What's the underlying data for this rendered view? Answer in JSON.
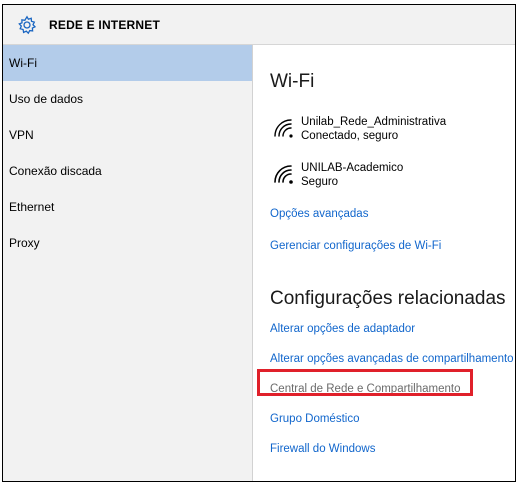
{
  "titlebar": {
    "icon": "gear-icon",
    "title": "REDE E INTERNET"
  },
  "sidebar": {
    "items": [
      {
        "label": "Wi-Fi",
        "active": true
      },
      {
        "label": "Uso de dados"
      },
      {
        "label": "VPN"
      },
      {
        "label": "Conexão discada"
      },
      {
        "label": "Ethernet"
      },
      {
        "label": "Proxy"
      }
    ]
  },
  "main": {
    "heading": "Wi-Fi",
    "networks": [
      {
        "name": "Unilab_Rede_Administrativa",
        "status": "Conectado, seguro",
        "icon": "wifi-signal-icon"
      },
      {
        "name": "UNILAB-Academico",
        "status": "Seguro",
        "icon": "wifi-signal-icon"
      }
    ],
    "links": {
      "advanced": "Opções avançadas",
      "manage": "Gerenciar configurações de Wi-Fi"
    },
    "related_heading": "Configurações relacionadas",
    "related": {
      "adapter": "Alterar opções de adaptador",
      "sharing": "Alterar opções avançadas de compartilhamento",
      "center": "Central de Rede e Compartilhamento",
      "homegroup": "Grupo Doméstico",
      "firewall": "Firewall do Windows"
    }
  },
  "colors": {
    "accent": "#1166cc",
    "sidebar_active": "#b3ccea",
    "highlight": "#e0202a"
  }
}
